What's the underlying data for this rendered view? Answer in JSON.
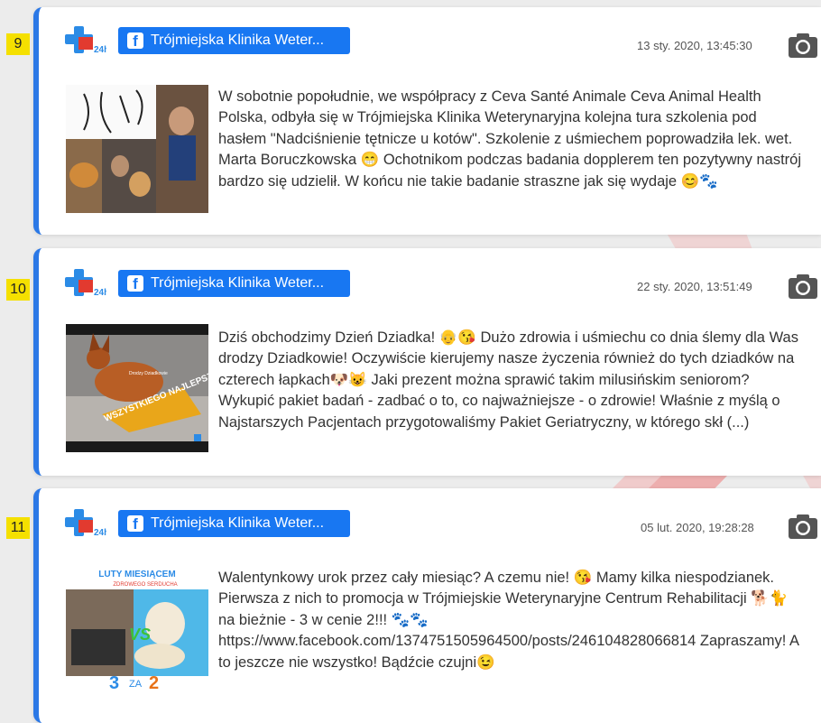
{
  "posts": [
    {
      "number": "9",
      "source": "Trójmiejska Klinika Weter...",
      "date": "13 sty. 2020, 13:45:30",
      "text": "W sobotnie popołudnie, we współpracy z Ceva Santé Animale Ceva Animal Health Polska, odbyła się w Trójmiejska Klinika Weterynaryjna kolejna tura szkolenia pod hasłem \"Nadciśnienie tętnicze u kotów\". Szkolenie z uśmiechem poprowadziła lek. wet. Marta Boruczkowska 😁 Ochotnikom podczas badania dopplerem ten pozytywny nastrój bardzo się udzielił. W końcu nie takie badanie straszne jak się wydaje 😊🐾"
    },
    {
      "number": "10",
      "source": "Trójmiejska Klinika Weter...",
      "date": "22 sty. 2020, 13:51:49",
      "text": "Dziś obchodzimy Dzień Dziadka! 👴😘 Dużo zdrowia i uśmiechu co dnia ślemy dla Was drodzy Dziadkowie! Oczywiście kierujemy nasze życzenia również do tych dziadków na czterech łapkach🐶😺 Jaki prezent można sprawić takim milusińskim seniorom? Wykupić pakiet badań - zadbać o to, co najważniejsze - o zdrowie! Właśnie z myślą o Najstarszych Pacjentach przygotowaliśmy Pakiet Geriatryczny, w którego skł (...)",
      "image_caption": "Drodzy Dziadkowie",
      "image_banner": "WSZYSTKIEGO NAJLEPSZEGO"
    },
    {
      "number": "11",
      "source": "Trójmiejska Klinika Weter...",
      "date": "05 lut. 2020, 19:28:28",
      "text": "Walentynkowy urok przez cały miesiąc? A czemu nie! 😘 Mamy kilka niespodzianek. Pierwsza z nich to promocja w Trójmiejskie Weterynaryjne Centrum Rehabilitacji 🐕🐈 na bieżnie - 3 w cenie 2!!! 🐾🐾 https://www.facebook.com/1374751505964500/posts/246104828066814 Zapraszamy! A to jeszcze nie wszystko! Bądźcie czujni😉",
      "image_title": "LUTY MIESIĄCEM",
      "image_subtitle": "ZDROWEGO SERDUCHA",
      "image_vs": "VS",
      "image_promo_3": "3",
      "image_promo_za": "ZA",
      "image_promo_2": "2"
    }
  ],
  "logo_badge": "24h",
  "colors": {
    "accent": "#2b78e6",
    "facebook": "#1877f2",
    "number_badge": "#f5e000",
    "watermark": "#e8262a"
  }
}
